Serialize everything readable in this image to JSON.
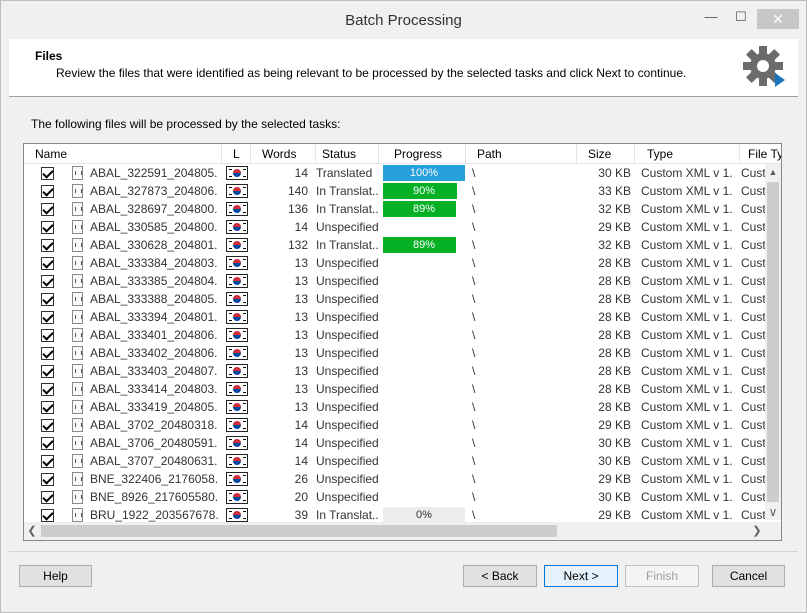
{
  "window": {
    "title": "Batch Processing",
    "min_label": "—",
    "max_label": "☐",
    "close_label": "✕"
  },
  "header": {
    "title": "Files",
    "description": "Review the files that were identified as being relevant to be processed by the selected tasks and click Next to continue."
  },
  "intro": "The following files will be processed by the selected tasks:",
  "columns": {
    "name": "Name",
    "lang": "L",
    "words": "Words",
    "status": "Status",
    "progress": "Progress",
    "path": "Path",
    "size": "Size",
    "type": "Type",
    "file_type": "File Ty"
  },
  "rows": [
    {
      "name": "ABAL_322591_204805...",
      "words": "14",
      "status": "Translated",
      "progress": "100%",
      "progress_value": 100,
      "progress_color": "#26a0da",
      "path": "\\",
      "size": "30 KB",
      "type": "Custom XML v 1...",
      "file_type": "Cust"
    },
    {
      "name": "ABAL_327873_204806...",
      "words": "140",
      "status": "In Translat...",
      "progress": "90%",
      "progress_value": 90,
      "progress_color": "#06b025",
      "path": "\\",
      "size": "33 KB",
      "type": "Custom XML v 1...",
      "file_type": "Cust"
    },
    {
      "name": "ABAL_328697_204800...",
      "words": "136",
      "status": "In Translat...",
      "progress": "89%",
      "progress_value": 89,
      "progress_color": "#06b025",
      "path": "\\",
      "size": "32 KB",
      "type": "Custom XML v 1...",
      "file_type": "Cust"
    },
    {
      "name": "ABAL_330585_204800...",
      "words": "14",
      "status": "Unspecified",
      "progress": "",
      "progress_value": 0,
      "progress_color": "",
      "path": "\\",
      "size": "29 KB",
      "type": "Custom XML v 1...",
      "file_type": "Cust"
    },
    {
      "name": "ABAL_330628_204801...",
      "words": "132",
      "status": "In Translat...",
      "progress": "89%",
      "progress_value": 89,
      "progress_color": "#06b025",
      "path": "\\",
      "size": "32 KB",
      "type": "Custom XML v 1...",
      "file_type": "Cust"
    },
    {
      "name": "ABAL_333384_204803...",
      "words": "13",
      "status": "Unspecified",
      "progress": "",
      "progress_value": 0,
      "progress_color": "",
      "path": "\\",
      "size": "28 KB",
      "type": "Custom XML v 1...",
      "file_type": "Cust"
    },
    {
      "name": "ABAL_333385_204804...",
      "words": "13",
      "status": "Unspecified",
      "progress": "",
      "progress_value": 0,
      "progress_color": "",
      "path": "\\",
      "size": "28 KB",
      "type": "Custom XML v 1...",
      "file_type": "Cust"
    },
    {
      "name": "ABAL_333388_204805...",
      "words": "13",
      "status": "Unspecified",
      "progress": "",
      "progress_value": 0,
      "progress_color": "",
      "path": "\\",
      "size": "28 KB",
      "type": "Custom XML v 1...",
      "file_type": "Cust"
    },
    {
      "name": "ABAL_333394_204801...",
      "words": "13",
      "status": "Unspecified",
      "progress": "",
      "progress_value": 0,
      "progress_color": "",
      "path": "\\",
      "size": "28 KB",
      "type": "Custom XML v 1...",
      "file_type": "Cust"
    },
    {
      "name": "ABAL_333401_204806...",
      "words": "13",
      "status": "Unspecified",
      "progress": "",
      "progress_value": 0,
      "progress_color": "",
      "path": "\\",
      "size": "28 KB",
      "type": "Custom XML v 1...",
      "file_type": "Cust"
    },
    {
      "name": "ABAL_333402_204806...",
      "words": "13",
      "status": "Unspecified",
      "progress": "",
      "progress_value": 0,
      "progress_color": "",
      "path": "\\",
      "size": "28 KB",
      "type": "Custom XML v 1...",
      "file_type": "Cust"
    },
    {
      "name": "ABAL_333403_204807...",
      "words": "13",
      "status": "Unspecified",
      "progress": "",
      "progress_value": 0,
      "progress_color": "",
      "path": "\\",
      "size": "28 KB",
      "type": "Custom XML v 1...",
      "file_type": "Cust"
    },
    {
      "name": "ABAL_333414_204803...",
      "words": "13",
      "status": "Unspecified",
      "progress": "",
      "progress_value": 0,
      "progress_color": "",
      "path": "\\",
      "size": "28 KB",
      "type": "Custom XML v 1...",
      "file_type": "Cust"
    },
    {
      "name": "ABAL_333419_204805...",
      "words": "13",
      "status": "Unspecified",
      "progress": "",
      "progress_value": 0,
      "progress_color": "",
      "path": "\\",
      "size": "28 KB",
      "type": "Custom XML v 1...",
      "file_type": "Cust"
    },
    {
      "name": "ABAL_3702_20480318...",
      "words": "14",
      "status": "Unspecified",
      "progress": "",
      "progress_value": 0,
      "progress_color": "",
      "path": "\\",
      "size": "29 KB",
      "type": "Custom XML v 1...",
      "file_type": "Cust"
    },
    {
      "name": "ABAL_3706_20480591...",
      "words": "14",
      "status": "Unspecified",
      "progress": "",
      "progress_value": 0,
      "progress_color": "",
      "path": "\\",
      "size": "30 KB",
      "type": "Custom XML v 1...",
      "file_type": "Cust"
    },
    {
      "name": "ABAL_3707_20480631...",
      "words": "14",
      "status": "Unspecified",
      "progress": "",
      "progress_value": 0,
      "progress_color": "",
      "path": "\\",
      "size": "30 KB",
      "type": "Custom XML v 1...",
      "file_type": "Cust"
    },
    {
      "name": "BNE_322406_2176058...",
      "words": "26",
      "status": "Unspecified",
      "progress": "",
      "progress_value": 0,
      "progress_color": "",
      "path": "\\",
      "size": "29 KB",
      "type": "Custom XML v 1...",
      "file_type": "Cust"
    },
    {
      "name": "BNE_8926_217605580...",
      "words": "20",
      "status": "Unspecified",
      "progress": "",
      "progress_value": 0,
      "progress_color": "",
      "path": "\\",
      "size": "30 KB",
      "type": "Custom XML v 1...",
      "file_type": "Cust"
    },
    {
      "name": "BRU_1922_203567678...",
      "words": "39",
      "status": "In Translat...",
      "progress": "0%",
      "progress_value": 0,
      "progress_color": "",
      "path": "\\",
      "size": "29 KB",
      "type": "Custom XML v 1...",
      "file_type": "Cust"
    }
  ],
  "scroll": {
    "up": "▲",
    "down": "∨",
    "left": "❮",
    "right": "❯"
  },
  "buttons": {
    "help": "Help",
    "back": "< Back",
    "next": "Next >",
    "finish": "Finish",
    "cancel": "Cancel"
  },
  "icons": {
    "gear": "gear-icon",
    "file": "file-xml-icon",
    "flag": "korean-flag-icon"
  }
}
